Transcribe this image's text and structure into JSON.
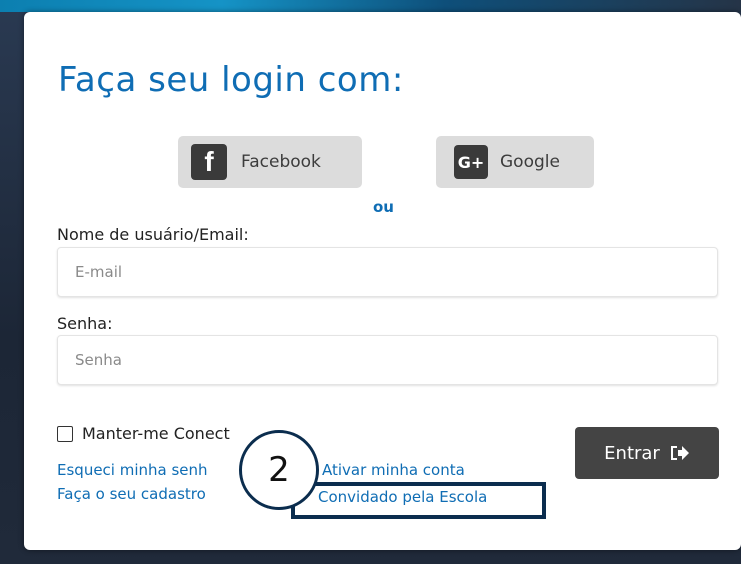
{
  "title": "Faça seu login com:",
  "social": {
    "facebook_label": "Facebook",
    "facebook_icon": "f",
    "google_label": "Google",
    "google_icon": "G+"
  },
  "separator": "ou",
  "username": {
    "label": "Nome de usuário/Email:",
    "placeholder": "E-mail"
  },
  "password": {
    "label": "Senha:",
    "placeholder": "Senha"
  },
  "remember": {
    "label": "Manter-me Conect"
  },
  "links": {
    "forgot": "Esqueci minha senh",
    "signup": "Faça o seu cadastro",
    "activate": "Ativar minha conta",
    "invited": "Convidado pela Escola"
  },
  "submit": {
    "label": "Entrar"
  },
  "callout": {
    "number": "2"
  },
  "colors": {
    "accent": "#0f6db4",
    "callout_border": "#0b2d4e",
    "button_bg": "#444444"
  }
}
